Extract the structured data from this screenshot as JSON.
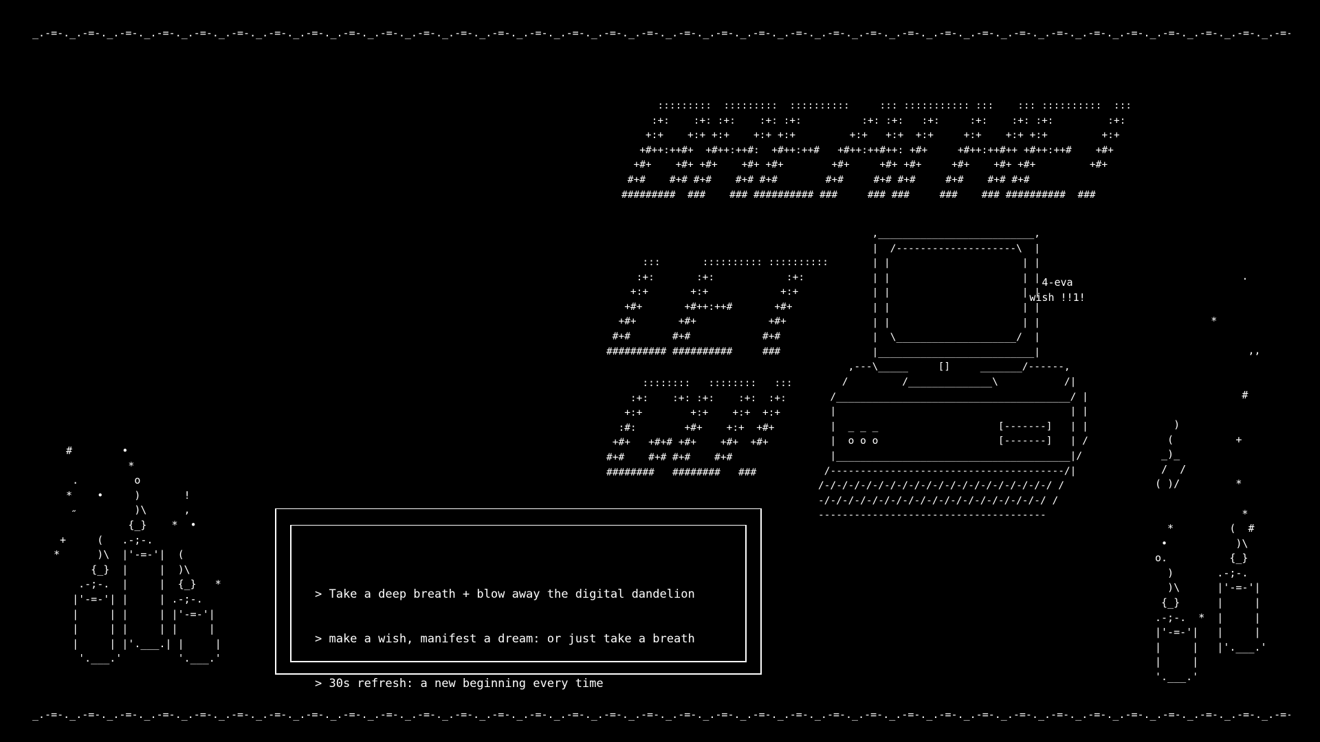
{
  "border": {
    "pattern": "_.-=-."
  },
  "banner": {
    "art": "      :::::::::  :::::::::  ::::::::::     ::: ::::::::::: :::    ::: ::::::::::  :::\n     :+:    :+: :+:    :+: :+:          :+: :+:   :+:     :+:    :+: :+:         :+:\n    +:+    +:+ +:+    +:+ +:+         +:+   +:+  +:+     +:+    +:+ +:+         +:+\n   +#++:++#+  +#++:++#:  +#++:++#   +#++:++#++: +#+     +#++:++#++ +#++:++#    +#+\n  +#+    +#+ +#+    +#+ +#+        +#+     +#+ +#+     +#+    +#+ +#+         +#+\n #+#    #+# #+#    #+# #+#        #+#     #+# #+#     #+#    #+# #+#\n#########  ###    ### ########## ###     ### ###     ###    ### ##########  ###"
  },
  "ai_art": {
    "art": "      :::       :::::::::: ::::::::::\n     :+:       :+:            :+:\n    +:+       +:+            +:+\n   +#+       +#++:++#       +#+\n  +#+       +#+            +#+\n #+#       #+#            #+#\n########## ##########     ###"
  },
  "sig_art": {
    "art": "      ::::::::   ::::::::   :::\n    :+:    :+: :+:    :+:  :+:\n   +:+        +:+    +:+  +:+\n  :#:        +#+    +:+  +#+\n +#+   +#+# +#+    +#+  +#+\n#+#    #+# #+#    #+#\n########   ########   ###"
  },
  "computer": {
    "art": "         ,__________________________,\n         |  /--------------------\\  |\n         | |                      | |\n         | |                      | |\n         | |                      | |\n         | |                      | |\n         | |                      | |\n         |  \\____________________/  |\n         |__________________________|\n     ,---\\_____     []     _______/------,\n    /         /______________\\           /|\n  /_______________________________________/ |\n  |                                       | |\n  |  _ _ _                    [-------]   | |\n  |  o o o                    [-------]   | /\n  |_______________________________________|/\n /---------------------------------------/|\n/-/-/-/-/-/-/-/-/-/-/-/-/-/-/-/-/-/-/-/ /\n-/-/-/-/-/-/-/-/-/-/-/-/-/-/-/-/-/-/-/ /\n--------------------------------------",
    "screen_line1": "4-eva",
    "screen_line2": "wish !!1!"
  },
  "textbox": {
    "lines": [
      "> Take a deep breath + blow away the digital dandelion",
      "> make a wish, manifest a dream: or just take a breath",
      "> 30s refresh: a new beginning every time"
    ]
  },
  "left_jars": {
    "art": "  #        •\n            *\n   .         o\n  *    •     )       !\n   ˶         )\\      ,\n            {_}    *  •\n +     (   .-;-.\n*      )\\  |'-=-'|  (\n      {_}  |     |  )\\\n    .-;-.  |     |  {_}   *\n   |'-=-'| |     | .-;-.\n   |     | |     | |'-=-'|\n   |     | |     | |     |\n   |     | |'.___.| |     |\n    '.___.'         '.___.'"
  },
  "right_jar": {
    "art": "              .\n\n\n         *\n\n               ,,\n\n\n              #\n\n   )\n  (          +\n _)_\n /  /\n( )/         *\n\n              *\n  *         (  #\n •           )\\\no.          {_}\n  )       .-;-.\n  )\\      |'-=-'|\n {_}      |     |\n.-;-.  *  |     |\n|'-=-'|   |     |\n|     |   |'.___.'\n|     |\n'.___.'"
  }
}
